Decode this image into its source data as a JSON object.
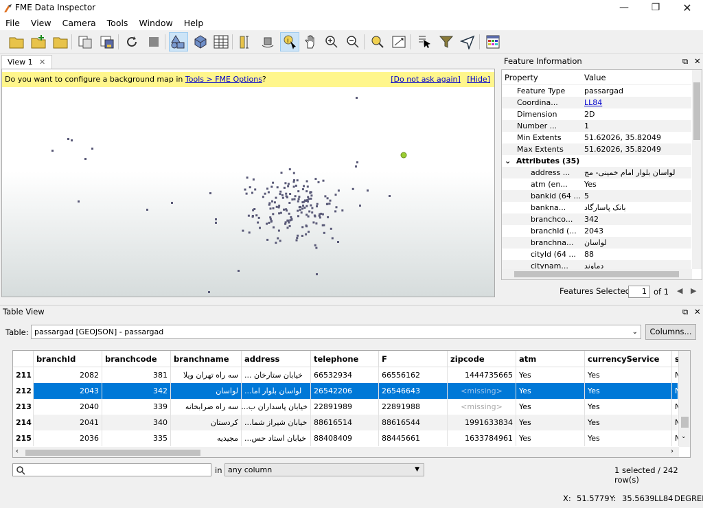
{
  "app": {
    "title": "FME Data Inspector"
  },
  "menu": [
    "File",
    "View",
    "Camera",
    "Tools",
    "Window",
    "Help"
  ],
  "view": {
    "tab_label": "View 1",
    "banner_text": "Do you want to configure a background map in ",
    "banner_link": "Tools > FME Options",
    "banner_suffix": "?",
    "banner_dont_ask": "[Do not ask again]",
    "banner_hide": "[Hide]"
  },
  "feature_info": {
    "title": "Feature Information",
    "col_property": "Property",
    "col_value": "Value",
    "rows": [
      {
        "k": "Feature Type",
        "v": "passargad"
      },
      {
        "k": "Coordina...",
        "v": "LL84"
      },
      {
        "k": "Dimension",
        "v": "2D"
      },
      {
        "k": "Number ...",
        "v": "1"
      },
      {
        "k": "Min Extents",
        "v": "51.62026, 35.82049"
      },
      {
        "k": "Max Extents",
        "v": "51.62026, 35.82049"
      }
    ],
    "attributes_label": "Attributes (35)",
    "attributes": [
      {
        "k": "address ...",
        "v": "لواسان  بلوار امام خمینی- مج"
      },
      {
        "k": "atm (en...",
        "v": "Yes"
      },
      {
        "k": "bankid (64 ...",
        "v": "5"
      },
      {
        "k": "bankna...",
        "v": "بانک پاسارگاد"
      },
      {
        "k": "branchco...",
        "v": "342"
      },
      {
        "k": "branchId (...",
        "v": "2043"
      },
      {
        "k": "branchna...",
        "v": "لواسان"
      },
      {
        "k": "cityId (64 ...",
        "v": "88"
      },
      {
        "k": "citynam...",
        "v": "دماوند"
      }
    ],
    "features_selected_label": "Features Selected:",
    "features_selected_value": "1",
    "features_of": "of 1"
  },
  "table_view": {
    "title": "Table View",
    "table_label": "Table:",
    "table_value": "passargad [GEOJSON] - passargad",
    "columns_button": "Columns...",
    "headers": [
      "branchId",
      "branchcode",
      "branchname",
      "address",
      "telephone",
      "F",
      "zipcode",
      "atm",
      "currencyService",
      "s"
    ],
    "rows": [
      {
        "n": "211",
        "c": [
          "2082",
          "381",
          "سه راه تهران ویلا",
          "خیابان ستارخان  ...",
          "66532934",
          "66556162",
          "1444735665",
          "Yes",
          "Yes",
          "N"
        ]
      },
      {
        "n": "212",
        "c": [
          "2043",
          "342",
          "لواسان",
          "لواسان  بلوار اما...",
          "26542206",
          "26546643",
          "<missing>",
          "Yes",
          "Yes",
          "N"
        ]
      },
      {
        "n": "213",
        "c": [
          "2040",
          "339",
          "سه راه ضرابخانه",
          "خیابان پاسداران  ب...",
          "22891989",
          "22891988",
          "<missing>",
          "Yes",
          "Yes",
          "N"
        ]
      },
      {
        "n": "214",
        "c": [
          "2041",
          "340",
          "کردستان",
          "خیابان شیراز شما...",
          "88616514",
          "88616544",
          "1991633834",
          "Yes",
          "Yes",
          "N"
        ]
      },
      {
        "n": "215",
        "c": [
          "2036",
          "335",
          "مجیدیه",
          "خیابان استاد حس...",
          "88408409",
          "88445661",
          "1633784961",
          "Yes",
          "Yes",
          "N"
        ]
      }
    ],
    "in_label": "in",
    "column_filter": "any column",
    "row_count": "1 selected / 242 row(s)"
  },
  "status": {
    "x_label": "X:",
    "x": "51.5779",
    "y_label": "Y:",
    "y": "35.5639",
    "crs": "LL84",
    "units": "DEGREE"
  },
  "colors": {
    "selection": "#0078d7",
    "banner": "#fff68c",
    "point": "#5a5a78",
    "selected_point": "#9acd32"
  }
}
